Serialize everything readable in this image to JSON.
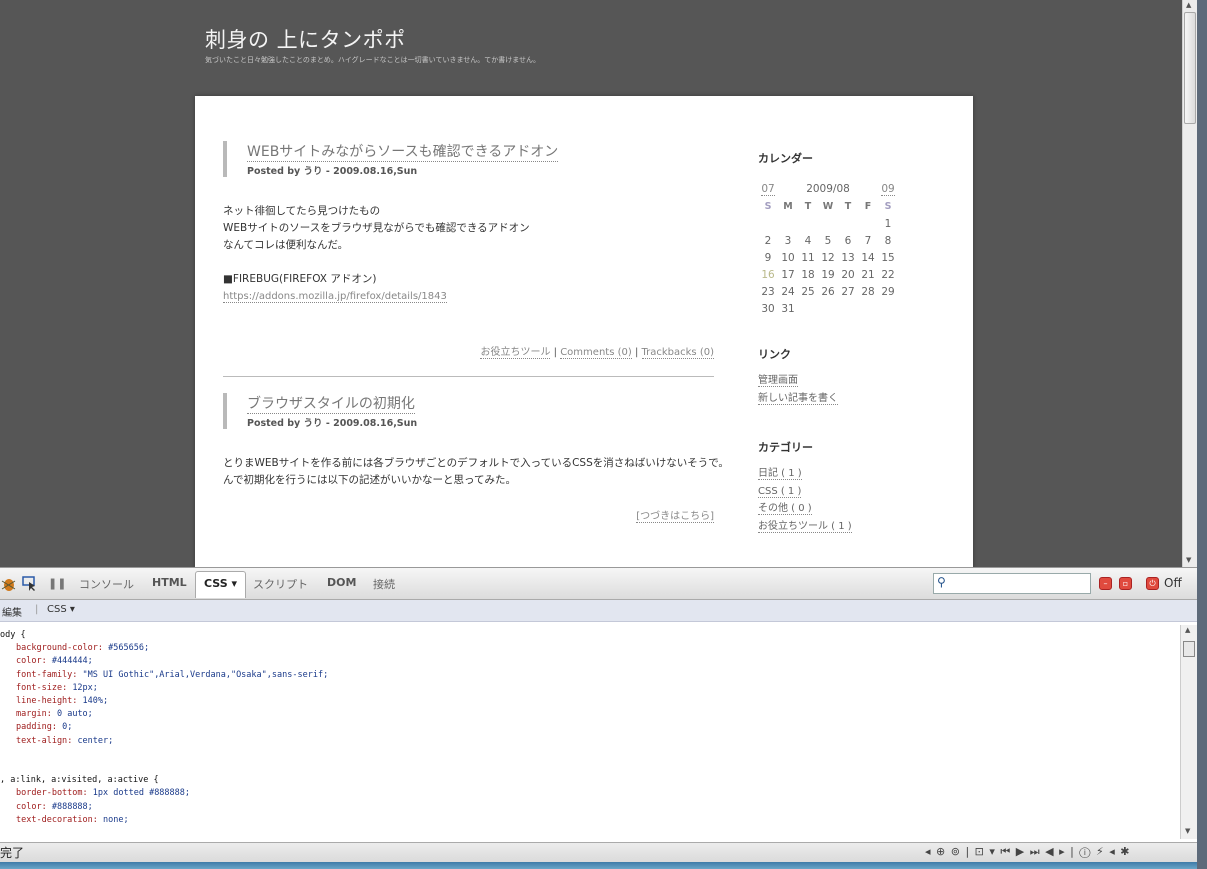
{
  "blog": {
    "title": "刺身の 上にタンポポ",
    "description": "気づいたこと日々勉強したことのまとめ。ハイグレードなことは一切書いていきません。てか書けません。",
    "posts": [
      {
        "title": "WEBサイトみながらソースも確認できるアドオン",
        "meta": "Posted by うり - 2009.08.16,Sun",
        "lines": [
          "ネット徘徊してたら見つけたもの",
          "WEBサイトのソースをブラウザ見ながらでも確認できるアドオン",
          "なんてコレは便利なんだ。",
          "",
          "■FIREBUG(FIREFOX アドオン)"
        ],
        "link": "https://addons.mozilla.jp/firefox/details/1843",
        "footer": {
          "category": "お役立ちツール",
          "comments": "Comments (0)",
          "trackbacks": "Trackbacks (0)",
          "sep": " | "
        }
      },
      {
        "title": "ブラウザスタイルの初期化",
        "meta": "Posted by うり - 2009.08.16,Sun",
        "lines": [
          "とりまWEBサイトを作る前には各ブラウザごとのデフォルトで入っているCSSを消さねばいけないそうで。",
          "んで初期化を行うには以下の記述がいいかなーと思ってみた。"
        ],
        "more": "[つづきはこちら]"
      }
    ],
    "sidebar": {
      "calendar_title": "カレンダー",
      "calendar": {
        "prev": "07",
        "month": "2009/08",
        "next": "09",
        "dow": [
          "S",
          "M",
          "T",
          "W",
          "T",
          "F",
          "S"
        ],
        "weeks": [
          [
            "",
            "",
            "",
            "",
            "",
            "",
            "1"
          ],
          [
            "2",
            "3",
            "4",
            "5",
            "6",
            "7",
            "8"
          ],
          [
            "9",
            "10",
            "11",
            "12",
            "13",
            "14",
            "15"
          ],
          [
            "16",
            "17",
            "18",
            "19",
            "20",
            "21",
            "22"
          ],
          [
            "23",
            "24",
            "25",
            "26",
            "27",
            "28",
            "29"
          ],
          [
            "30",
            "31",
            "",
            "",
            "",
            "",
            ""
          ]
        ],
        "highlight": "16"
      },
      "links_title": "リンク",
      "links": [
        "管理画面",
        "新しい記事を書く"
      ],
      "categories_title": "カテゴリー",
      "categories": [
        "日記 ( 1 )",
        "CSS ( 1 )",
        "その他 ( 0 )",
        "お役立ちツール ( 1 )"
      ]
    }
  },
  "firebug": {
    "tabs": [
      "コンソール",
      "HTML",
      "CSS ▾",
      "スクリプト",
      "DOM",
      "接続"
    ],
    "active_tab": "CSS ▾",
    "off_label": "Off",
    "subbar": {
      "edit": "編集",
      "sep": "|",
      "file": "CSS ▾"
    },
    "css_rules": [
      {
        "selector": "ody {",
        "decls": [
          [
            "background-color",
            "#565656;"
          ],
          [
            "color",
            "#444444;"
          ],
          [
            "font-family",
            "\"MS UI Gothic\",Arial,Verdana,\"Osaka\",sans-serif;"
          ],
          [
            "font-size",
            "12px;"
          ],
          [
            "line-height",
            "140%;"
          ],
          [
            "margin",
            "0 auto;"
          ],
          [
            "padding",
            "0;"
          ],
          [
            "text-align",
            "center;"
          ]
        ],
        "close": ""
      },
      {
        "selector": ", a:link, a:visited, a:active {",
        "decls": [
          [
            "border-bottom",
            "1px dotted #888888;"
          ],
          [
            "color",
            "#888888;"
          ],
          [
            "text-decoration",
            "none;"
          ]
        ],
        "close": ""
      }
    ]
  },
  "status": {
    "text": "完了",
    "icons": "◂ ⊕ ⊚ | ⊡ ▾ ⏮ ▶ ⏭ ◀ ▸ | ⓘ ⚡ ◂ ✱"
  }
}
